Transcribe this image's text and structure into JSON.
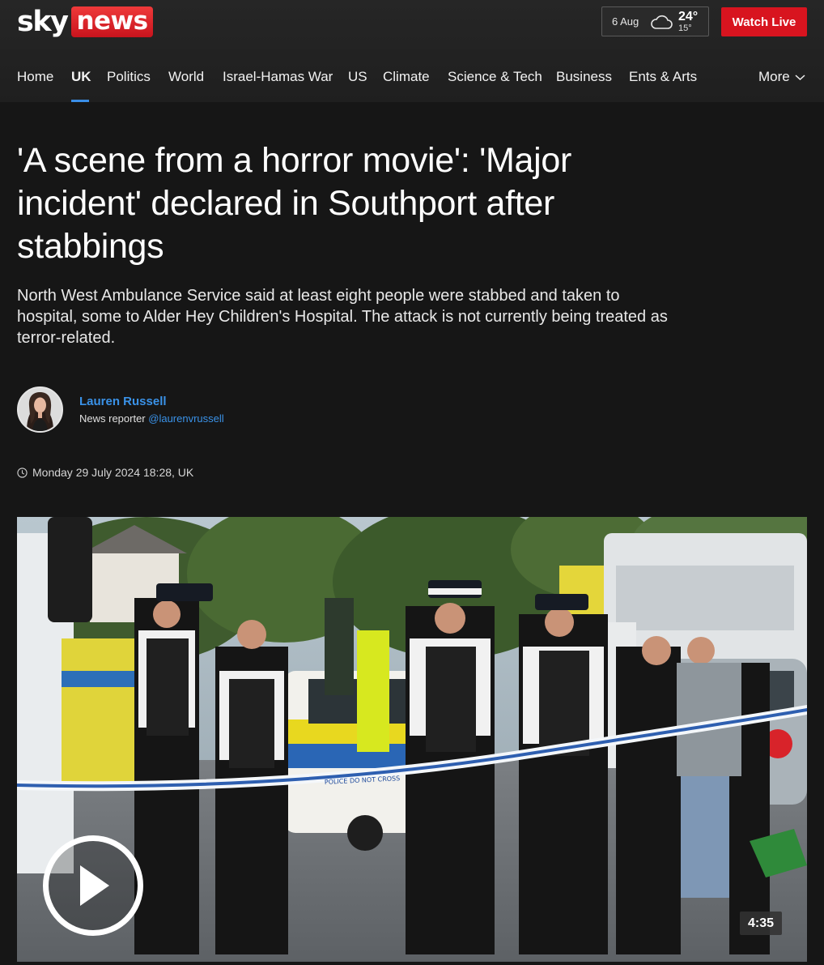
{
  "header": {
    "logo_sky": "sky",
    "logo_news": "news",
    "weather": {
      "date": "6 Aug",
      "high": "24°",
      "low": "15°",
      "icon": "cloud-icon"
    },
    "watch_live": "Watch Live"
  },
  "nav": {
    "items": [
      "Home",
      "UK",
      "Politics",
      "World",
      "Israel-Hamas War",
      "US",
      "Climate",
      "Science & Tech",
      "Business",
      "Ents & Arts"
    ],
    "active": "UK",
    "more": "More",
    "accent": "#3a8ee6"
  },
  "article": {
    "headline": "'A scene from a horror movie': 'Major incident' declared in Southport after stabbings",
    "standfirst": "North West Ambulance Service said at least eight people were stabbed and taken to hospital, some to Alder Hey Children's Hospital. The attack is not currently being treated as terror-related.",
    "author": {
      "name": "Lauren Russell",
      "role": "News reporter",
      "handle": "@laurenvrussell"
    },
    "date": "Monday 29 July 2024 18:28, UK"
  },
  "video": {
    "duration": "4:35",
    "play_icon": "play-icon",
    "cordon_tape_text": "POLICE DO NOT CROSS"
  },
  "colors": {
    "background": "#161616",
    "brand_red": "#d8141f",
    "link_blue": "#3a92e8"
  }
}
